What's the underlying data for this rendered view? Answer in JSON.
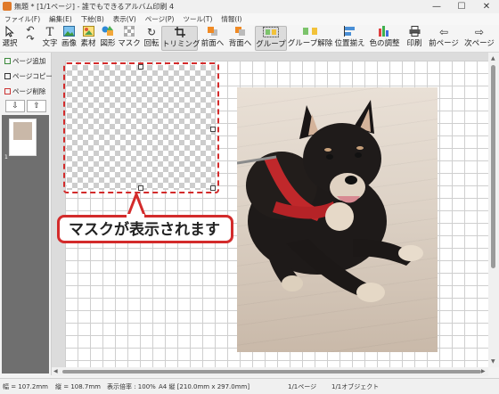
{
  "window": {
    "title": "無題 * [1/1ページ] - 誰でもできるアルバム印刷 4",
    "controls": {
      "minimize": "—",
      "maximize": "☐",
      "close": "✕"
    }
  },
  "menu": [
    "ファイル(F)",
    "編集(E)",
    "下絵(B)",
    "表示(V)",
    "ページ(P)",
    "ツール(T)",
    "情報(I)"
  ],
  "toolbar": {
    "select": "選択",
    "text": "文字",
    "image": "画像",
    "material": "素材",
    "shape": "図形",
    "mask": "マスク",
    "rotate": "回転",
    "trim": "トリミング",
    "bring_front": "前面へ",
    "send_back": "背面へ",
    "group": "グループ",
    "ungroup": "グループ解除",
    "align": "位置揃え",
    "color_adjust": "色の調整",
    "print": "印刷",
    "prev_page": "前ページ",
    "next_page": "次ページ"
  },
  "left_panel": {
    "add_page": "ページ追加",
    "copy_page": "ページコピー",
    "delete_page": "ページ削除",
    "thumbnail_page_number": "1"
  },
  "callout": {
    "text": "マスクが表示されます"
  },
  "status": {
    "width": "幅 = 107.2mm",
    "height": "縦 = 108.7mm",
    "zoom": "表示倍率 : 100%",
    "paper": "A4 縦 [210.0mm x 297.0mm]",
    "page": "1/1ページ",
    "object": "1/1オブジェクト"
  },
  "colors": {
    "accent_red": "#d32b2b",
    "thumb_panel": "#6f6f6f"
  }
}
